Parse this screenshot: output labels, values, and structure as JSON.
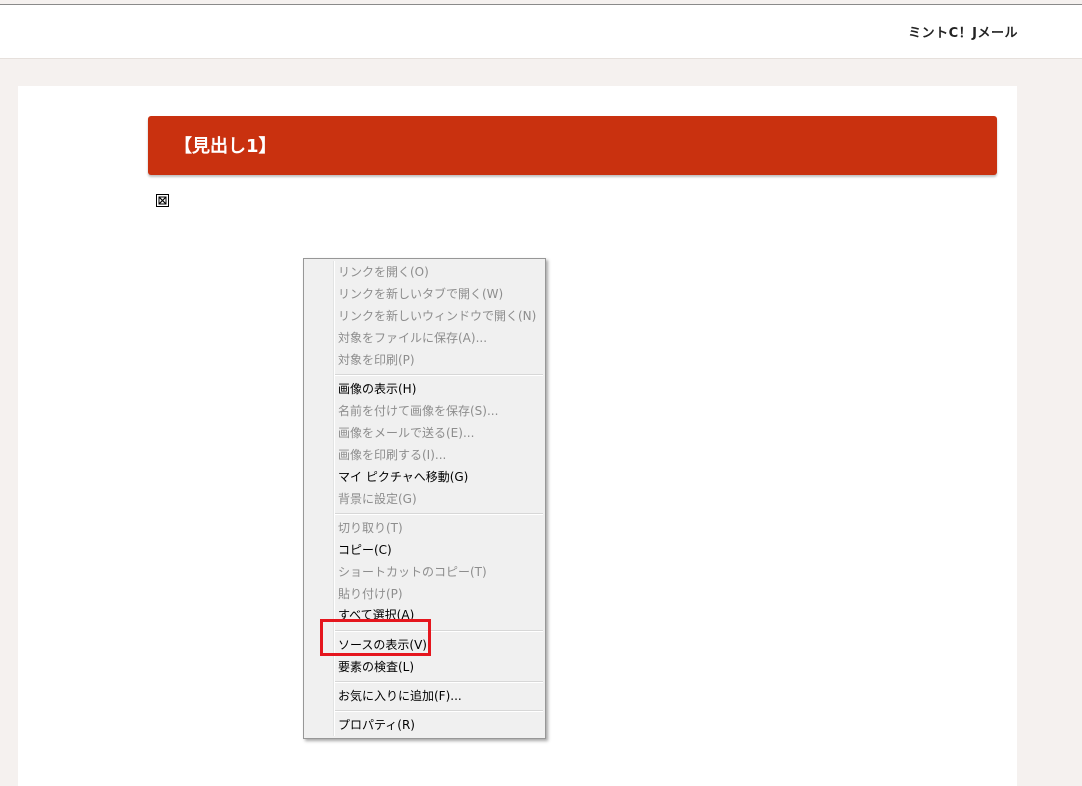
{
  "header": {
    "site_name": "ミントC！Jメール"
  },
  "article": {
    "heading": "【見出し1】"
  },
  "context_menu": {
    "items": [
      {
        "label": "リンクを開く(O)",
        "enabled": false
      },
      {
        "label": "リンクを新しいタブで開く(W)",
        "enabled": false
      },
      {
        "label": "リンクを新しいウィンドウで開く(N)",
        "enabled": false
      },
      {
        "label": "対象をファイルに保存(A)...",
        "enabled": false
      },
      {
        "label": "対象を印刷(P)",
        "enabled": false
      },
      {
        "label": "画像の表示(H)",
        "enabled": true
      },
      {
        "label": "名前を付けて画像を保存(S)...",
        "enabled": false
      },
      {
        "label": "画像をメールで送る(E)...",
        "enabled": false
      },
      {
        "label": "画像を印刷する(I)...",
        "enabled": false
      },
      {
        "label": "マイ ピクチャへ移動(G)",
        "enabled": true
      },
      {
        "label": "背景に設定(G)",
        "enabled": false
      },
      {
        "label": "切り取り(T)",
        "enabled": false
      },
      {
        "label": "コピー(C)",
        "enabled": true
      },
      {
        "label": "ショートカットのコピー(T)",
        "enabled": false
      },
      {
        "label": "貼り付け(P)",
        "enabled": false
      },
      {
        "label": "すべて選択(A)",
        "enabled": true
      },
      {
        "label": "ソースの表示(V)",
        "enabled": true
      },
      {
        "label": "要素の検査(L)",
        "enabled": true
      },
      {
        "label": "お気に入りに追加(F)...",
        "enabled": true
      },
      {
        "label": "プロパティ(R)",
        "enabled": true
      }
    ]
  },
  "colors": {
    "heading_bg": "#c9310f",
    "highlight": "#e5161e",
    "disabled_text": "#8d8d8d"
  },
  "icons": {
    "broken_image": "broken-image-icon"
  }
}
